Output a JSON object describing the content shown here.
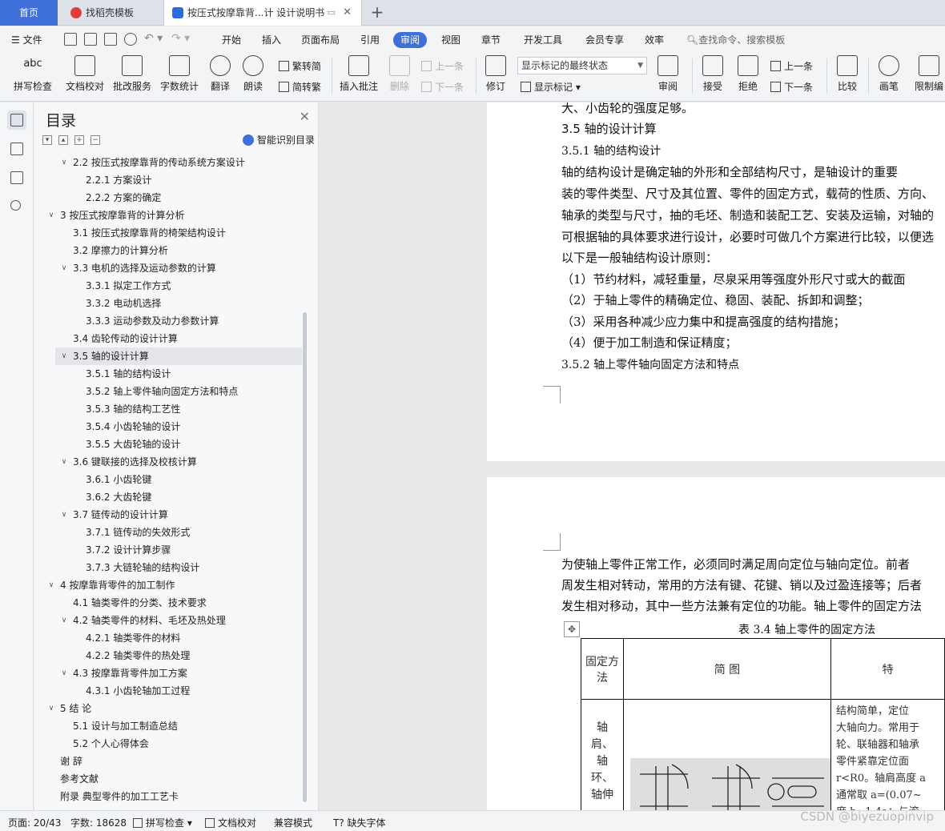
{
  "tabs": {
    "home": "首页",
    "templates": "找稻壳模板",
    "doc": "按压式按摩靠背...计 设计说明书"
  },
  "menu": {
    "file": "文件",
    "items": [
      "开始",
      "插入",
      "页面布局",
      "引用",
      "审阅",
      "视图",
      "章节",
      "开发工具",
      "会员专享",
      "效率"
    ],
    "active": "审阅",
    "search_placeholder": "查找命令、搜索模板"
  },
  "ribbon": {
    "spell": "拼写检查",
    "doc_check": "文档校对",
    "batch": "批改服务",
    "word_count": "字数统计",
    "translate": "翻译",
    "read": "朗读",
    "to_trad": "繁转简",
    "to_simp": "简转繁",
    "insert_comment": "插入批注",
    "delete": "删除",
    "prev_comment": "上一条",
    "next_comment": "下一条",
    "track": "修订",
    "markup_state": "显示标记的最终状态",
    "show_markup": "显示标记",
    "review": "审阅",
    "accept": "接受",
    "reject": "拒绝",
    "prev_change": "上一条",
    "next_change": "下一条",
    "compare": "比较",
    "pen": "画笔",
    "restrict": "限制编"
  },
  "toc": {
    "title": "目录",
    "smart": "智能识别目录",
    "items": [
      {
        "text": "2.2  按压式按摩靠背的传动系统方案设计",
        "level": 2,
        "arrow": "open"
      },
      {
        "text": "2.2.1 方案设计",
        "level": 3
      },
      {
        "text": "2.2.2 方案的确定",
        "level": 3
      },
      {
        "text": "3    按压式按摩靠背的计算分析",
        "level": 1,
        "arrow": "open"
      },
      {
        "text": "3.1  按压式按摩靠背的椅架结构设计",
        "level": 2
      },
      {
        "text": "3.2  摩擦力的计算分析",
        "level": 2
      },
      {
        "text": "3.3  电机的选择及运动参数的计算",
        "level": 2,
        "arrow": "open"
      },
      {
        "text": "3.3.1 拟定工作方式",
        "level": 3
      },
      {
        "text": "3.3.2 电动机选择",
        "level": 3
      },
      {
        "text": "3.3.3 运动参数及动力参数计算",
        "level": 3
      },
      {
        "text": "3.4  齿轮传动的设计计算",
        "level": 2
      },
      {
        "text": "3.5  轴的设计计算",
        "level": 2,
        "arrow": "open",
        "selected": true
      },
      {
        "text": "3.5.1 轴的结构设计",
        "level": 3
      },
      {
        "text": "3.5.2 轴上零件轴向固定方法和特点",
        "level": 3
      },
      {
        "text": "3.5.3 轴的结构工艺性",
        "level": 3
      },
      {
        "text": "3.5.4 小齿轮轴的设计",
        "level": 3
      },
      {
        "text": "3.5.5 大齿轮轴的设计",
        "level": 3
      },
      {
        "text": "3.6  键联接的选择及校核计算",
        "level": 2,
        "arrow": "open"
      },
      {
        "text": "3.6.1 小齿轮键",
        "level": 3
      },
      {
        "text": "3.6.2 大齿轮键",
        "level": 3
      },
      {
        "text": "3.7  链传动的设计计算",
        "level": 2,
        "arrow": "open"
      },
      {
        "text": "3.7.1 链传动的失效形式",
        "level": 3
      },
      {
        "text": "3.7.2 设计计算步骤",
        "level": 3
      },
      {
        "text": "3.7.3 大链轮轴的结构设计",
        "level": 3
      },
      {
        "text": "4    按摩靠背零件的加工制作",
        "level": 1,
        "arrow": "open"
      },
      {
        "text": "4.1  轴类零件的分类、技术要求",
        "level": 2
      },
      {
        "text": "4.2  轴类零件的材料、毛坯及热处理",
        "level": 2,
        "arrow": "open"
      },
      {
        "text": "4.2.1 轴类零件的材料",
        "level": 3
      },
      {
        "text": "4.2.2 轴类零件的热处理",
        "level": 3
      },
      {
        "text": "4.3  按摩靠背零件加工方案",
        "level": 2,
        "arrow": "open"
      },
      {
        "text": "4.3.1 小齿轮轴加工过程",
        "level": 3
      },
      {
        "text": "5    结    论",
        "level": 1,
        "arrow": "open"
      },
      {
        "text": "5.1  设计与加工制造总结",
        "level": 2
      },
      {
        "text": "5.2  个人心得体会",
        "level": 2
      },
      {
        "text": "谢    辞",
        "level": 0
      },
      {
        "text": "参考文献",
        "level": 0
      },
      {
        "text": "附录  典型零件的加工工艺卡",
        "level": 0
      }
    ]
  },
  "doc": {
    "page1_lines": [
      {
        "text": "大、小齿轮的强度足够。",
        "cls": ""
      },
      {
        "text": "3.5  轴的设计计算",
        "cls": "h2"
      },
      {
        "text": "3.5.1 轴的结构设计",
        "cls": "h3"
      },
      {
        "text": "    轴的结构设计是确定轴的外形和全部结构尺寸，是轴设计的重要",
        "cls": ""
      },
      {
        "text": "装的零件类型、尺寸及其位置、零件的固定方式，载荷的性质、方向、",
        "cls": ""
      },
      {
        "text": "轴承的类型与尺寸，抽的毛坯、制造和装配工艺、安装及运输，对轴的",
        "cls": ""
      },
      {
        "text": "可根据轴的具体要求进行设计，必要时可做几个方案进行比较，以便选",
        "cls": ""
      },
      {
        "text": "以下是一般轴结构设计原则：",
        "cls": ""
      },
      {
        "text": "    （1）节约材料，减轻重量，尽泉采用等强度外形尺寸或大的截面",
        "cls": ""
      },
      {
        "text": "    （2）于轴上零件的精确定位、稳固、装配、拆卸和调整；",
        "cls": ""
      },
      {
        "text": "    （3）采用各种减少应力集中和提高强度的结构措施；",
        "cls": ""
      },
      {
        "text": "    （4）便于加工制造和保证精度；",
        "cls": ""
      },
      {
        "text": "3.5.2 轴上零件轴向固定方法和特点",
        "cls": "h3"
      }
    ],
    "page2_lines": [
      "    为使轴上零件正常工作，必须同时满足周向定位与轴向定位。前者",
      "周发生相对转动，常用的方法有键、花键、销以及过盈连接等；后者",
      "发生相对移动，其中一些方法兼有定位的功能。轴上零件的固定方法"
    ],
    "table_caption": "表 3.4 轴上零件的固定方法",
    "table_headers": [
      "固定方法",
      "简   图",
      "特"
    ],
    "table_row_method": "轴肩、轴环、轴伸",
    "table_row_desc": [
      "  结构简单，定位",
      "大轴向力。常用于",
      "轮、联轴器和轴承",
      "零件紧靠定位面",
      "r<R0。轴肩高度 a",
      "通常取 a=(0.07~",
      "度 b≈1.4a；与滚"
    ]
  },
  "status": {
    "page": "页面: 20/43",
    "words": "字数: 18628",
    "spell": "拼写检查",
    "proof": "文档校对",
    "compat": "兼容模式",
    "missing_font": "缺失字体"
  },
  "watermark": "CSDN @biyezuopinvip"
}
